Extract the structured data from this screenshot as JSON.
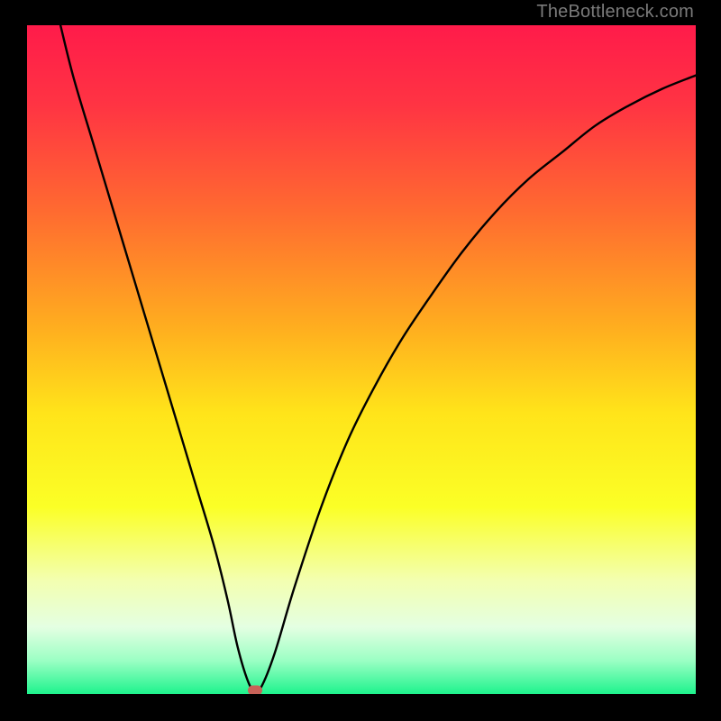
{
  "watermark": "TheBottleneck.com",
  "chart_data": {
    "type": "line",
    "title": "",
    "xlabel": "",
    "ylabel": "",
    "xlim": [
      0,
      100
    ],
    "ylim": [
      0,
      100
    ],
    "gradient_stops": [
      {
        "pct": 0,
        "color": "#ff1b4a"
      },
      {
        "pct": 12,
        "color": "#ff3443"
      },
      {
        "pct": 28,
        "color": "#ff6b30"
      },
      {
        "pct": 45,
        "color": "#ffad1f"
      },
      {
        "pct": 58,
        "color": "#ffe41a"
      },
      {
        "pct": 72,
        "color": "#fbff26"
      },
      {
        "pct": 83,
        "color": "#f3ffb0"
      },
      {
        "pct": 90,
        "color": "#e4ffe2"
      },
      {
        "pct": 95,
        "color": "#9bffc4"
      },
      {
        "pct": 100,
        "color": "#1ef38d"
      }
    ],
    "series": [
      {
        "name": "bottleneck-curve",
        "x": [
          5,
          7,
          10,
          13,
          16,
          19,
          22,
          25,
          28,
          30,
          31.5,
          33,
          34,
          35,
          37,
          40,
          44,
          48,
          52,
          56,
          60,
          65,
          70,
          75,
          80,
          85,
          90,
          95,
          100
        ],
        "y": [
          100,
          92,
          82,
          72,
          62,
          52,
          42,
          32,
          22,
          14,
          7,
          2,
          0.5,
          1,
          6,
          16,
          28,
          38,
          46,
          53,
          59,
          66,
          72,
          77,
          81,
          85,
          88,
          90.5,
          92.5
        ]
      }
    ],
    "marker": {
      "x": 34.1,
      "y": 0.6,
      "color": "#c86258"
    }
  }
}
